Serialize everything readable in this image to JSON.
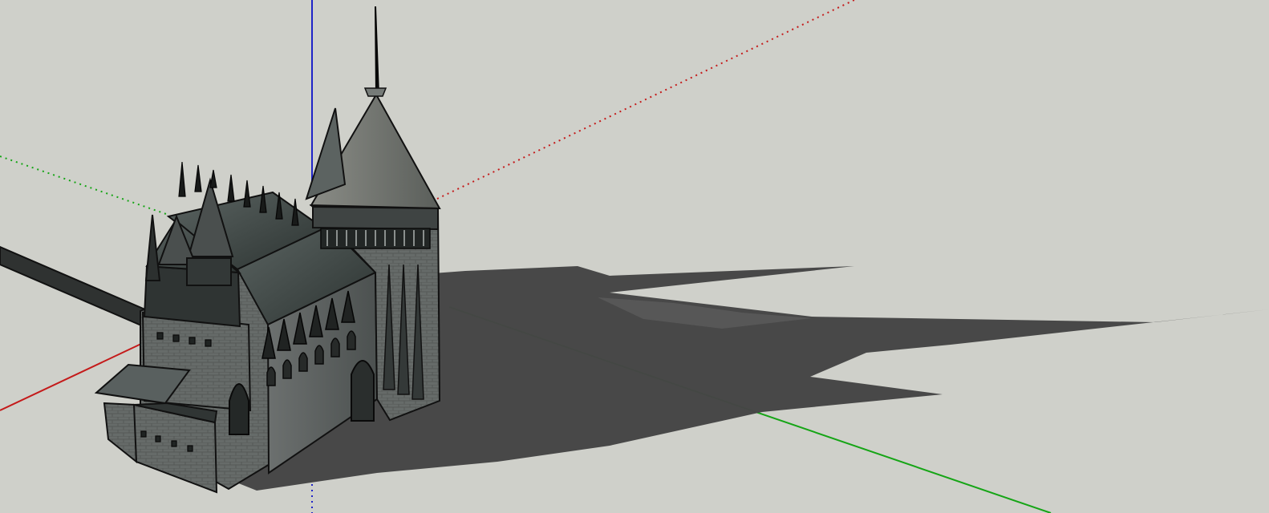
{
  "app": {
    "window_title": ""
  },
  "viewport": {
    "background_color": "#cfd0ca",
    "axes": {
      "red_color": "#c41a1a",
      "green_color": "#16a516",
      "blue_color": "#1f24c8"
    },
    "model": {
      "icon": "gothic-church-3d-model"
    },
    "shadow": {
      "color": "#454545"
    }
  }
}
